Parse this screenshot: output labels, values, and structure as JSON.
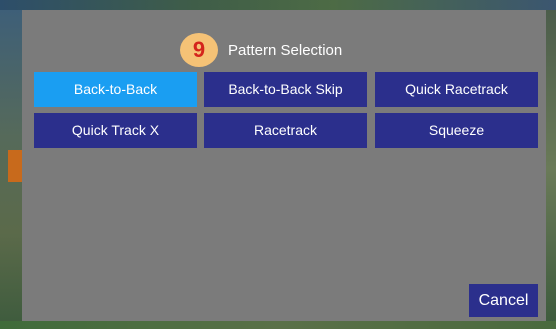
{
  "dialog": {
    "step_badge": "9",
    "title": "Pattern Selection",
    "cancel_label": "Cancel",
    "patterns": [
      {
        "label": "Back-to-Back",
        "selected": true
      },
      {
        "label": "Back-to-Back Skip",
        "selected": false
      },
      {
        "label": "Quick Racetrack",
        "selected": false
      },
      {
        "label": "Quick Track X",
        "selected": false
      },
      {
        "label": "Racetrack",
        "selected": false
      },
      {
        "label": "Squeeze",
        "selected": false
      }
    ]
  },
  "colors": {
    "dialog_bg": "#7b7b7b",
    "button_bg": "#2b2f8c",
    "selected_bg": "#1a9ef2",
    "badge_bg": "#f5c276",
    "badge_text": "#d4241c"
  }
}
